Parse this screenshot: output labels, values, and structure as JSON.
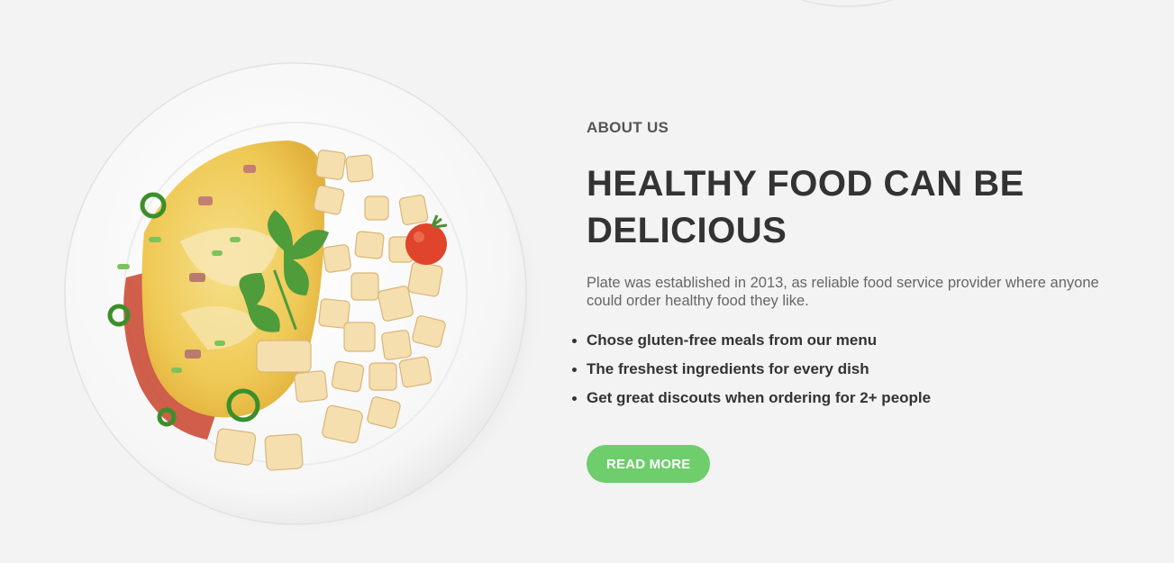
{
  "about": {
    "eyebrow": "ABOUT US",
    "title": "HEALTHY FOOD CAN BE DELICIOUS",
    "intro": "Plate was established in 2013, as reliable food service provider where anyone could order healthy food they like.",
    "features": [
      "Chose gluten-free meals from our menu",
      "The freshest ingredients for every dish",
      "Get great discouts when ordering for 2+ people"
    ],
    "cta_label": "READ MORE"
  },
  "colors": {
    "background": "#f3f3f3",
    "accent": "#6dce6b",
    "heading": "#333333",
    "body_text": "#666666"
  },
  "image": {
    "icon": "omelette-plate-illustration"
  }
}
